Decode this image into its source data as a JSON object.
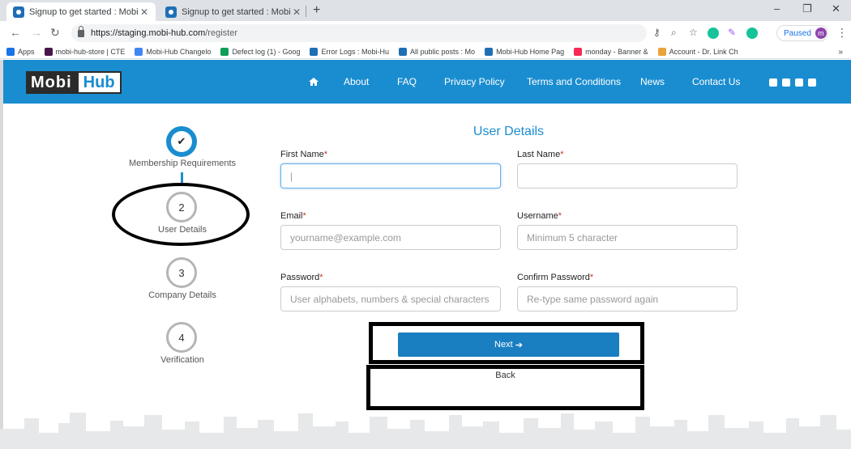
{
  "browser": {
    "tabs": [
      {
        "title": "Signup to get started : Mobi-Hub",
        "close": "✕"
      },
      {
        "title": "Signup to get started : Mobi-Hub",
        "close": "✕"
      }
    ],
    "new_tab": "+",
    "window_controls": {
      "minimize": "–",
      "restore": "❐",
      "close": "✕"
    },
    "url_host": "https://staging.mobi-hub.com",
    "url_path": "/register",
    "paused_label": "Paused",
    "avatar_letter": "m",
    "bookmarks": [
      {
        "label": "Apps",
        "color": "#1a73e8"
      },
      {
        "label": "mobi-hub-store | CTE",
        "color": "#4a154b"
      },
      {
        "label": "Mobi-Hub Changelo",
        "color": "#4285f4"
      },
      {
        "label": "Defect log (1) - Goog",
        "color": "#0f9d58"
      },
      {
        "label": "Error Logs : Mobi-Hu",
        "color": "#1f6fb6"
      },
      {
        "label": "All public posts : Mo",
        "color": "#1f6fb6"
      },
      {
        "label": "Mobi-Hub Home Pag",
        "color": "#1f6fb6"
      },
      {
        "label": "monday - Banner &",
        "color": "#f62b54"
      },
      {
        "label": "Account - Dr. Link Ch",
        "color": "#e8a43a"
      }
    ],
    "bookmarks_more": "»"
  },
  "site": {
    "logo_left": "Mobi",
    "logo_right": "Hub",
    "nav": [
      "About",
      "FAQ",
      "Privacy Policy",
      "Terms and Conditions",
      "News",
      "Contact Us"
    ],
    "header_color": "#1a8dd0"
  },
  "stepper": {
    "steps": [
      {
        "number": "✔",
        "label": "Membership Requirements",
        "state": "done"
      },
      {
        "number": "2",
        "label": "User Details",
        "state": "current"
      },
      {
        "number": "3",
        "label": "Company Details",
        "state": "pending"
      },
      {
        "number": "4",
        "label": "Verification",
        "state": "pending"
      }
    ]
  },
  "form": {
    "title": "User Details",
    "first_name": {
      "label": "First Name",
      "value": "|"
    },
    "last_name": {
      "label": "Last Name",
      "value": ""
    },
    "email": {
      "label": "Email",
      "placeholder": "yourname@example.com"
    },
    "username": {
      "label": "Username",
      "placeholder": "Minimum 5 character"
    },
    "password": {
      "label": "Password",
      "placeholder": "User alphabets, numbers & special characters"
    },
    "confirm_password": {
      "label": "Confirm Password",
      "placeholder": "Re-type same password again"
    },
    "required_mark": "*",
    "next_label": "Next",
    "next_arrow": "➔",
    "back_label": "Back"
  }
}
